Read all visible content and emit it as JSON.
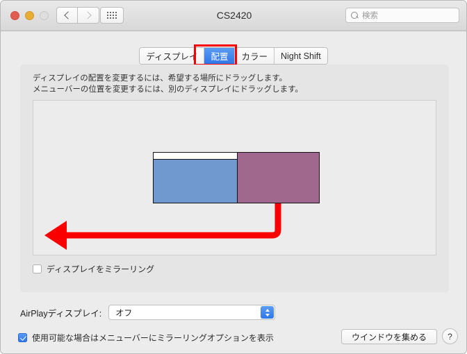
{
  "window": {
    "title": "CS2420",
    "traffic_lights": [
      "close-red",
      "minimize-yellow",
      "zoom-disabled"
    ],
    "nav": {
      "back_icon": "chevron-left-icon",
      "forward_icon": "chevron-right-icon"
    },
    "grid_button_icon": "grid-dots-icon",
    "search": {
      "placeholder": "検索",
      "value": "",
      "icon": "magnifier-icon"
    }
  },
  "tabs": [
    {
      "label": "ディスプレイ",
      "selected": false
    },
    {
      "label": "配置",
      "selected": true
    },
    {
      "label": "カラー",
      "selected": false
    },
    {
      "label": "Night Shift",
      "selected": false
    }
  ],
  "panel": {
    "instruction_line1": "ディスプレイの配置を変更するには、希望する場所にドラッグします。",
    "instruction_line2": "メニューバーの位置を変更するには、別のディスプレイにドラッグします。",
    "displays": [
      {
        "name": "primary-display",
        "color": "#7099cf",
        "has_menu_bar": true
      },
      {
        "name": "secondary-display",
        "color": "#a0688c",
        "has_menu_bar": false
      }
    ],
    "mirror_checkbox": {
      "label": "ディスプレイをミラーリング",
      "checked": false
    }
  },
  "annotation": {
    "highlight_color": "#f80000",
    "arrow_color": "#fa0000",
    "highlighted_tab": "配置"
  },
  "footer": {
    "airplay_label": "AirPlayディスプレイ:",
    "airplay_value": "オフ",
    "menubar_checkbox": {
      "label": "使用可能な場合はメニューバーにミラーリングオプションを表示",
      "checked": true
    },
    "gather_windows_label": "ウインドウを集める",
    "help_label": "?"
  }
}
